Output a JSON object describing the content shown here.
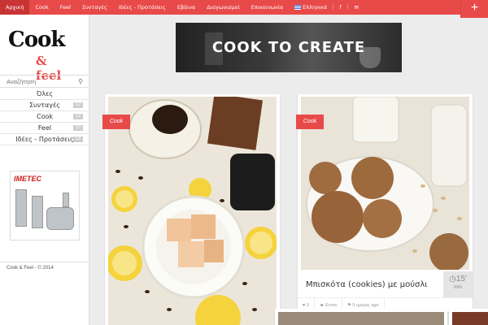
{
  "nav": {
    "items": [
      {
        "label": "Αρχική",
        "active": true
      },
      {
        "label": "Cook"
      },
      {
        "label": "Feel"
      },
      {
        "label": "Συνταγές"
      },
      {
        "label": "Ιδέες - Προτάσεις"
      },
      {
        "label": "Εβδινα"
      },
      {
        "label": "Διαγωνισμοί"
      },
      {
        "label": "Επικοινωνία"
      },
      {
        "label": "Ελληνικά"
      }
    ],
    "social": [
      "f",
      "✉"
    ],
    "plus_label": "+",
    "accent_color": "#e84a4a"
  },
  "sidebar": {
    "logo": {
      "word1": "Cook",
      "word2": "& feel"
    },
    "search_placeholder": "Αναζήτηση",
    "categories": [
      {
        "label": "Όλες",
        "count": ""
      },
      {
        "label": "Συνταγές",
        "count": "12"
      },
      {
        "label": "Cook",
        "count": "12"
      },
      {
        "label": "Feel",
        "count": "13"
      },
      {
        "label": "Ιδέες - Προτάσεις",
        "count": "13"
      }
    ],
    "ad_brand": "IMETEC",
    "footer": "Cook & Feel - © 2014"
  },
  "banner": {
    "text": "COOK TO CREATE"
  },
  "cards": [
    {
      "badge": "Cook"
    },
    {
      "badge": "Cook",
      "title": "Μπισκότα (cookies) με μούσλι",
      "time_value": "15'",
      "time_unit": "min",
      "likes": "0",
      "author": "Evina",
      "date": "5 ημέρες ago"
    }
  ]
}
